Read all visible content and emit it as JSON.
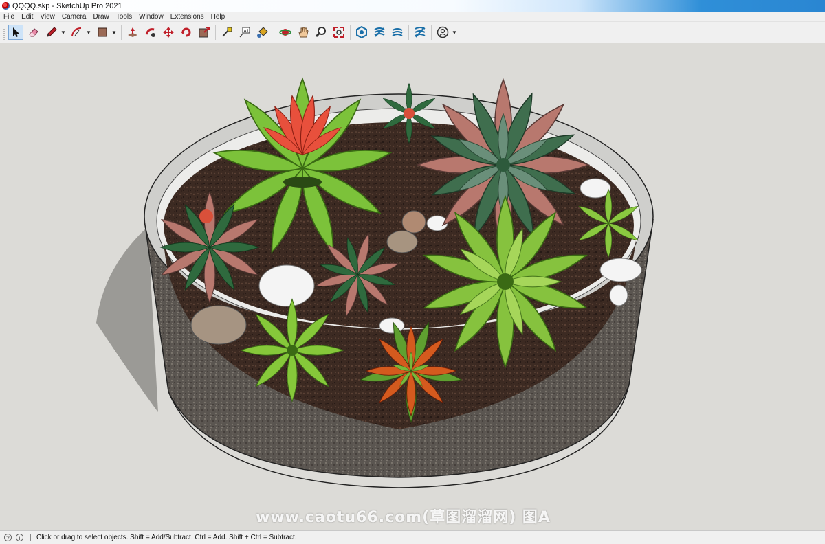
{
  "window": {
    "title": "QQQQ.skp - SketchUp Pro 2021"
  },
  "menu": [
    "File",
    "Edit",
    "View",
    "Camera",
    "Draw",
    "Tools",
    "Window",
    "Extensions",
    "Help"
  ],
  "toolbar": {
    "tools": [
      {
        "name": "select-tool",
        "icon": "arrow-cursor-icon",
        "active": true
      },
      {
        "name": "eraser-tool",
        "icon": "eraser-icon"
      },
      {
        "name": "pencil-tool",
        "icon": "pencil-icon",
        "dropdown": true
      },
      {
        "name": "arc-tool",
        "icon": "arc-icon",
        "dropdown": true
      },
      {
        "name": "shapes-tool",
        "icon": "rectangle-icon",
        "dropdown": true
      },
      {
        "name": "push-pull-tool",
        "icon": "push-pull-icon"
      },
      {
        "name": "follow-me-tool",
        "icon": "follow-me-icon"
      },
      {
        "name": "move-tool",
        "icon": "move-icon"
      },
      {
        "name": "rotate-tool",
        "icon": "rotate-icon"
      },
      {
        "name": "scale-tool",
        "icon": "scale-icon"
      },
      {
        "name": "tape-measure-tool",
        "icon": "tape-measure-icon"
      },
      {
        "name": "text-tool",
        "icon": "text-icon"
      },
      {
        "name": "paint-bucket-tool",
        "icon": "paint-bucket-icon"
      },
      {
        "name": "orbit-tool",
        "icon": "orbit-icon"
      },
      {
        "name": "pan-tool",
        "icon": "pan-hand-icon"
      },
      {
        "name": "zoom-tool",
        "icon": "zoom-icon"
      },
      {
        "name": "zoom-extents-tool",
        "icon": "zoom-extents-icon"
      },
      {
        "name": "warehouse-tool",
        "icon": "3d-warehouse-icon"
      },
      {
        "name": "extension-warehouse-tool",
        "icon": "extension-warehouse-icon"
      },
      {
        "name": "layout-tool",
        "icon": "layout-icon"
      },
      {
        "name": "extension-manager-tool",
        "icon": "extension-manager-icon"
      },
      {
        "name": "account-tool",
        "icon": "user-account-icon",
        "dropdown": true
      }
    ]
  },
  "watermark": "www.caotu66.com(草图溜溜网) 图A",
  "status": {
    "text": "Click or drag to select objects. Shift = Add/Subtract. Ctrl = Add. Shift + Ctrl = Subtract."
  }
}
